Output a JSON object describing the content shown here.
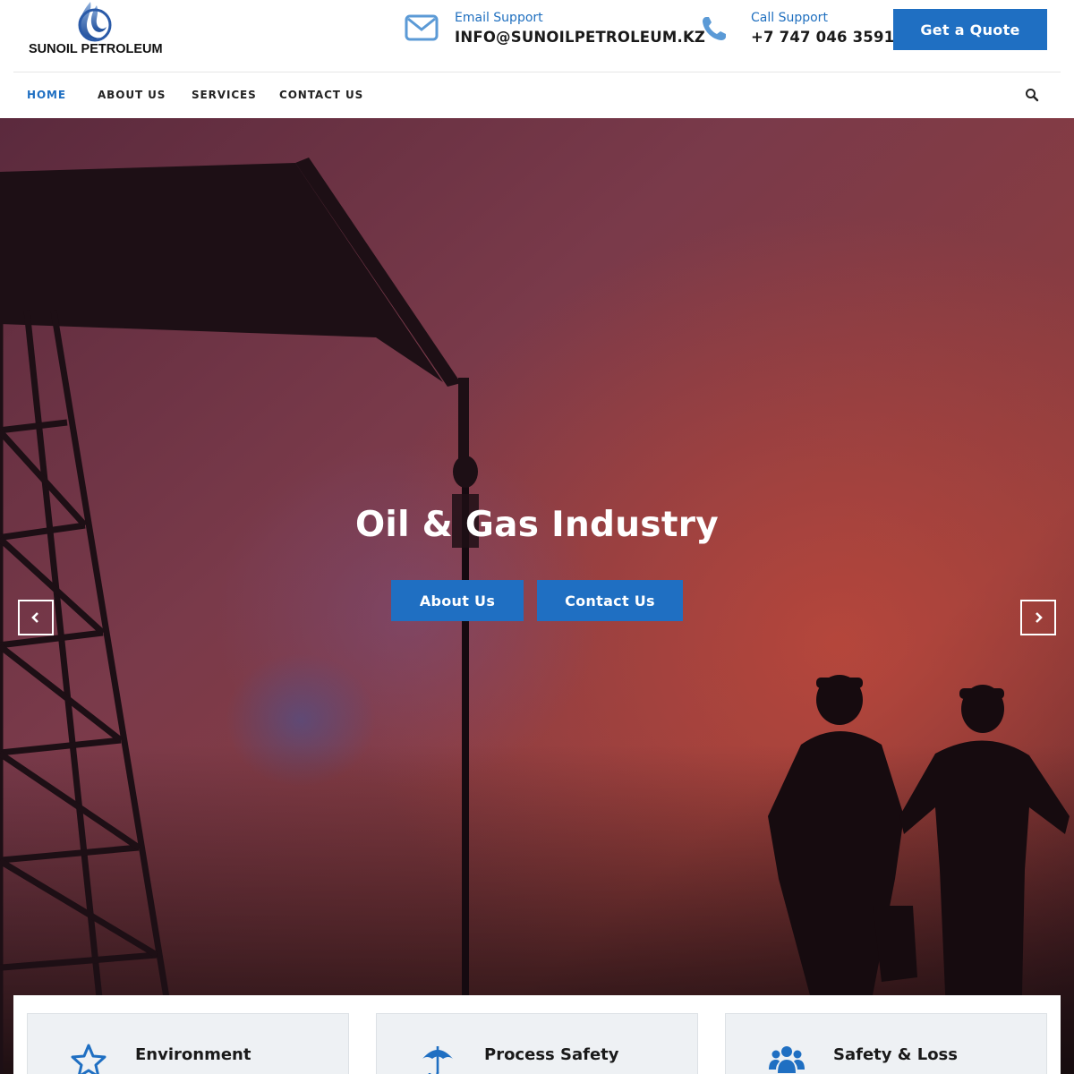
{
  "brand": {
    "name": "SUNOIL PETROLEUM",
    "logo_icon": "flame-logo-icon",
    "accent_color": "#1f6fc2"
  },
  "header": {
    "email": {
      "label": "Email Support",
      "value": "INFO@SUNOILPETROLEUM.KZ",
      "icon": "envelope-icon"
    },
    "phone": {
      "label": "Call Support",
      "value": "+7 747 046 3591",
      "icon": "phone-icon"
    },
    "quote_button": "Get a Quote"
  },
  "nav": {
    "items": [
      {
        "label": "HOME",
        "active": true
      },
      {
        "label": "ABOUT US",
        "active": false
      },
      {
        "label": "SERVICES",
        "active": false
      },
      {
        "label": "CONTACT US",
        "active": false
      }
    ],
    "search_icon": "search-icon"
  },
  "hero": {
    "title": "Oil & Gas Industry",
    "buttons": {
      "about": "About Us",
      "contact": "Contact Us"
    },
    "prev_icon": "chevron-left-icon",
    "next_icon": "chevron-right-icon"
  },
  "features": [
    {
      "title": "Environment",
      "icon": "star-icon"
    },
    {
      "title": "Process Safety",
      "icon": "umbrella-icon"
    },
    {
      "title": "Safety & Loss",
      "icon": "users-icon"
    }
  ]
}
